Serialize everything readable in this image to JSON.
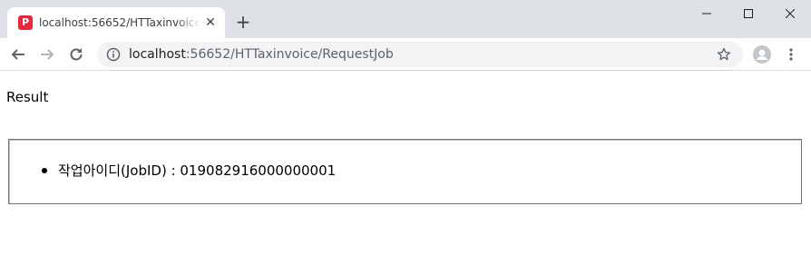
{
  "browser": {
    "tab": {
      "favicon_letter": "P",
      "title": "localhost:56652/HTTaxinvoice/RequestJob",
      "close_glyph": "✕"
    },
    "new_tab_glyph": "+",
    "address": {
      "host": "localhost",
      "rest": ":56652/HTTaxinvoice/RequestJob"
    },
    "icons": {
      "back": "back-arrow-icon",
      "forward": "forward-arrow-icon",
      "reload": "reload-icon",
      "info": "info-icon",
      "bookmark": "star-icon",
      "profile": "profile-icon",
      "menu": "kebab-menu-icon",
      "minimize": "minimize-icon",
      "maximize": "maximize-icon",
      "close": "close-icon"
    },
    "colors": {
      "tabstrip": "#dee1e6",
      "omnibox": "#f1f3f4",
      "favicon": "#e8283c"
    }
  },
  "page": {
    "heading": "Result",
    "results": [
      {
        "text": "작업아이디(JobID) : 019082916000000001"
      }
    ]
  }
}
